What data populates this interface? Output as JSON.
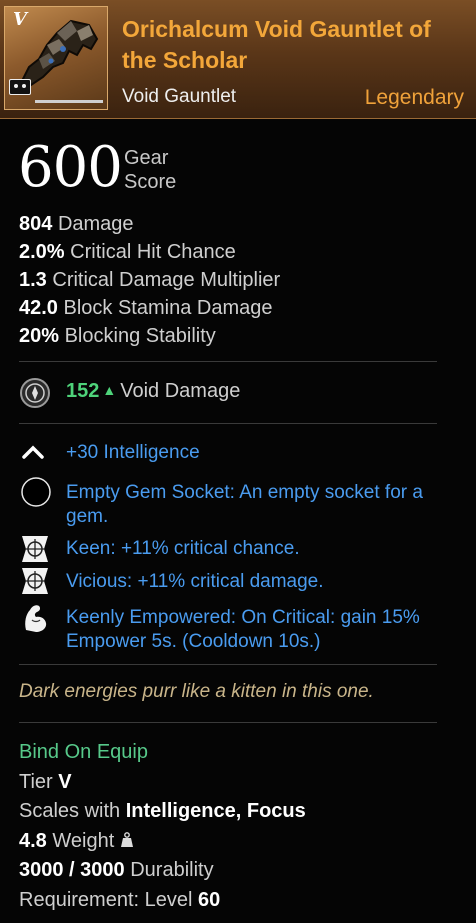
{
  "item": {
    "tier_mark": "V",
    "title": "Orichalcum Void Gauntlet of the Scholar",
    "subtype": "Void Gauntlet",
    "rarity": "Legendary"
  },
  "gear_score": {
    "value": "600",
    "label_line1": "Gear",
    "label_line2": "Score"
  },
  "stats": [
    {
      "value": "804",
      "label": "Damage"
    },
    {
      "value": "2.0%",
      "label": "Critical Hit Chance"
    },
    {
      "value": "1.3",
      "label": "Critical Damage Multiplier"
    },
    {
      "value": "42.0",
      "label": "Block Stamina Damage"
    },
    {
      "value": "20%",
      "label": "Blocking Stability"
    }
  ],
  "void_damage": {
    "value": "152",
    "arrow": "▲",
    "label": "Void Damage"
  },
  "perks": [
    {
      "icon": "chevron-up-icon",
      "text": "+30 Intelligence"
    },
    {
      "icon": "empty-gem-socket-icon",
      "name": "Empty Gem Socket:",
      "description": "An empty socket for a gem."
    },
    {
      "icon": "crosshair-icon",
      "name": "Keen:",
      "description": "+11% critical chance."
    },
    {
      "icon": "crosshair-icon",
      "name": "Vicious:",
      "description": "+11% critical damage."
    },
    {
      "icon": "flexed-arm-icon",
      "name": "Keenly Empowered:",
      "description": "On Critical: gain 15% Empower 5s. (Cooldown 10s.)"
    }
  ],
  "flavor_text": "Dark energies purr like a kitten in this one.",
  "footer": {
    "bind": "Bind On Equip",
    "tier_label": "Tier",
    "tier_value": "V",
    "scales_label": "Scales with",
    "scales_value": "Intelligence, Focus",
    "weight_value": "4.8",
    "weight_label": "Weight",
    "durability_value": "3000 / 3000",
    "durability_label": "Durability",
    "requirement_label": "Requirement: Level",
    "requirement_value": "60"
  },
  "colors": {
    "rarity": "#f0a23a",
    "perk_text": "#4a9cf0",
    "positive": "#4ed37a",
    "flavor": "#c9b58a",
    "bind": "#57c98a"
  }
}
